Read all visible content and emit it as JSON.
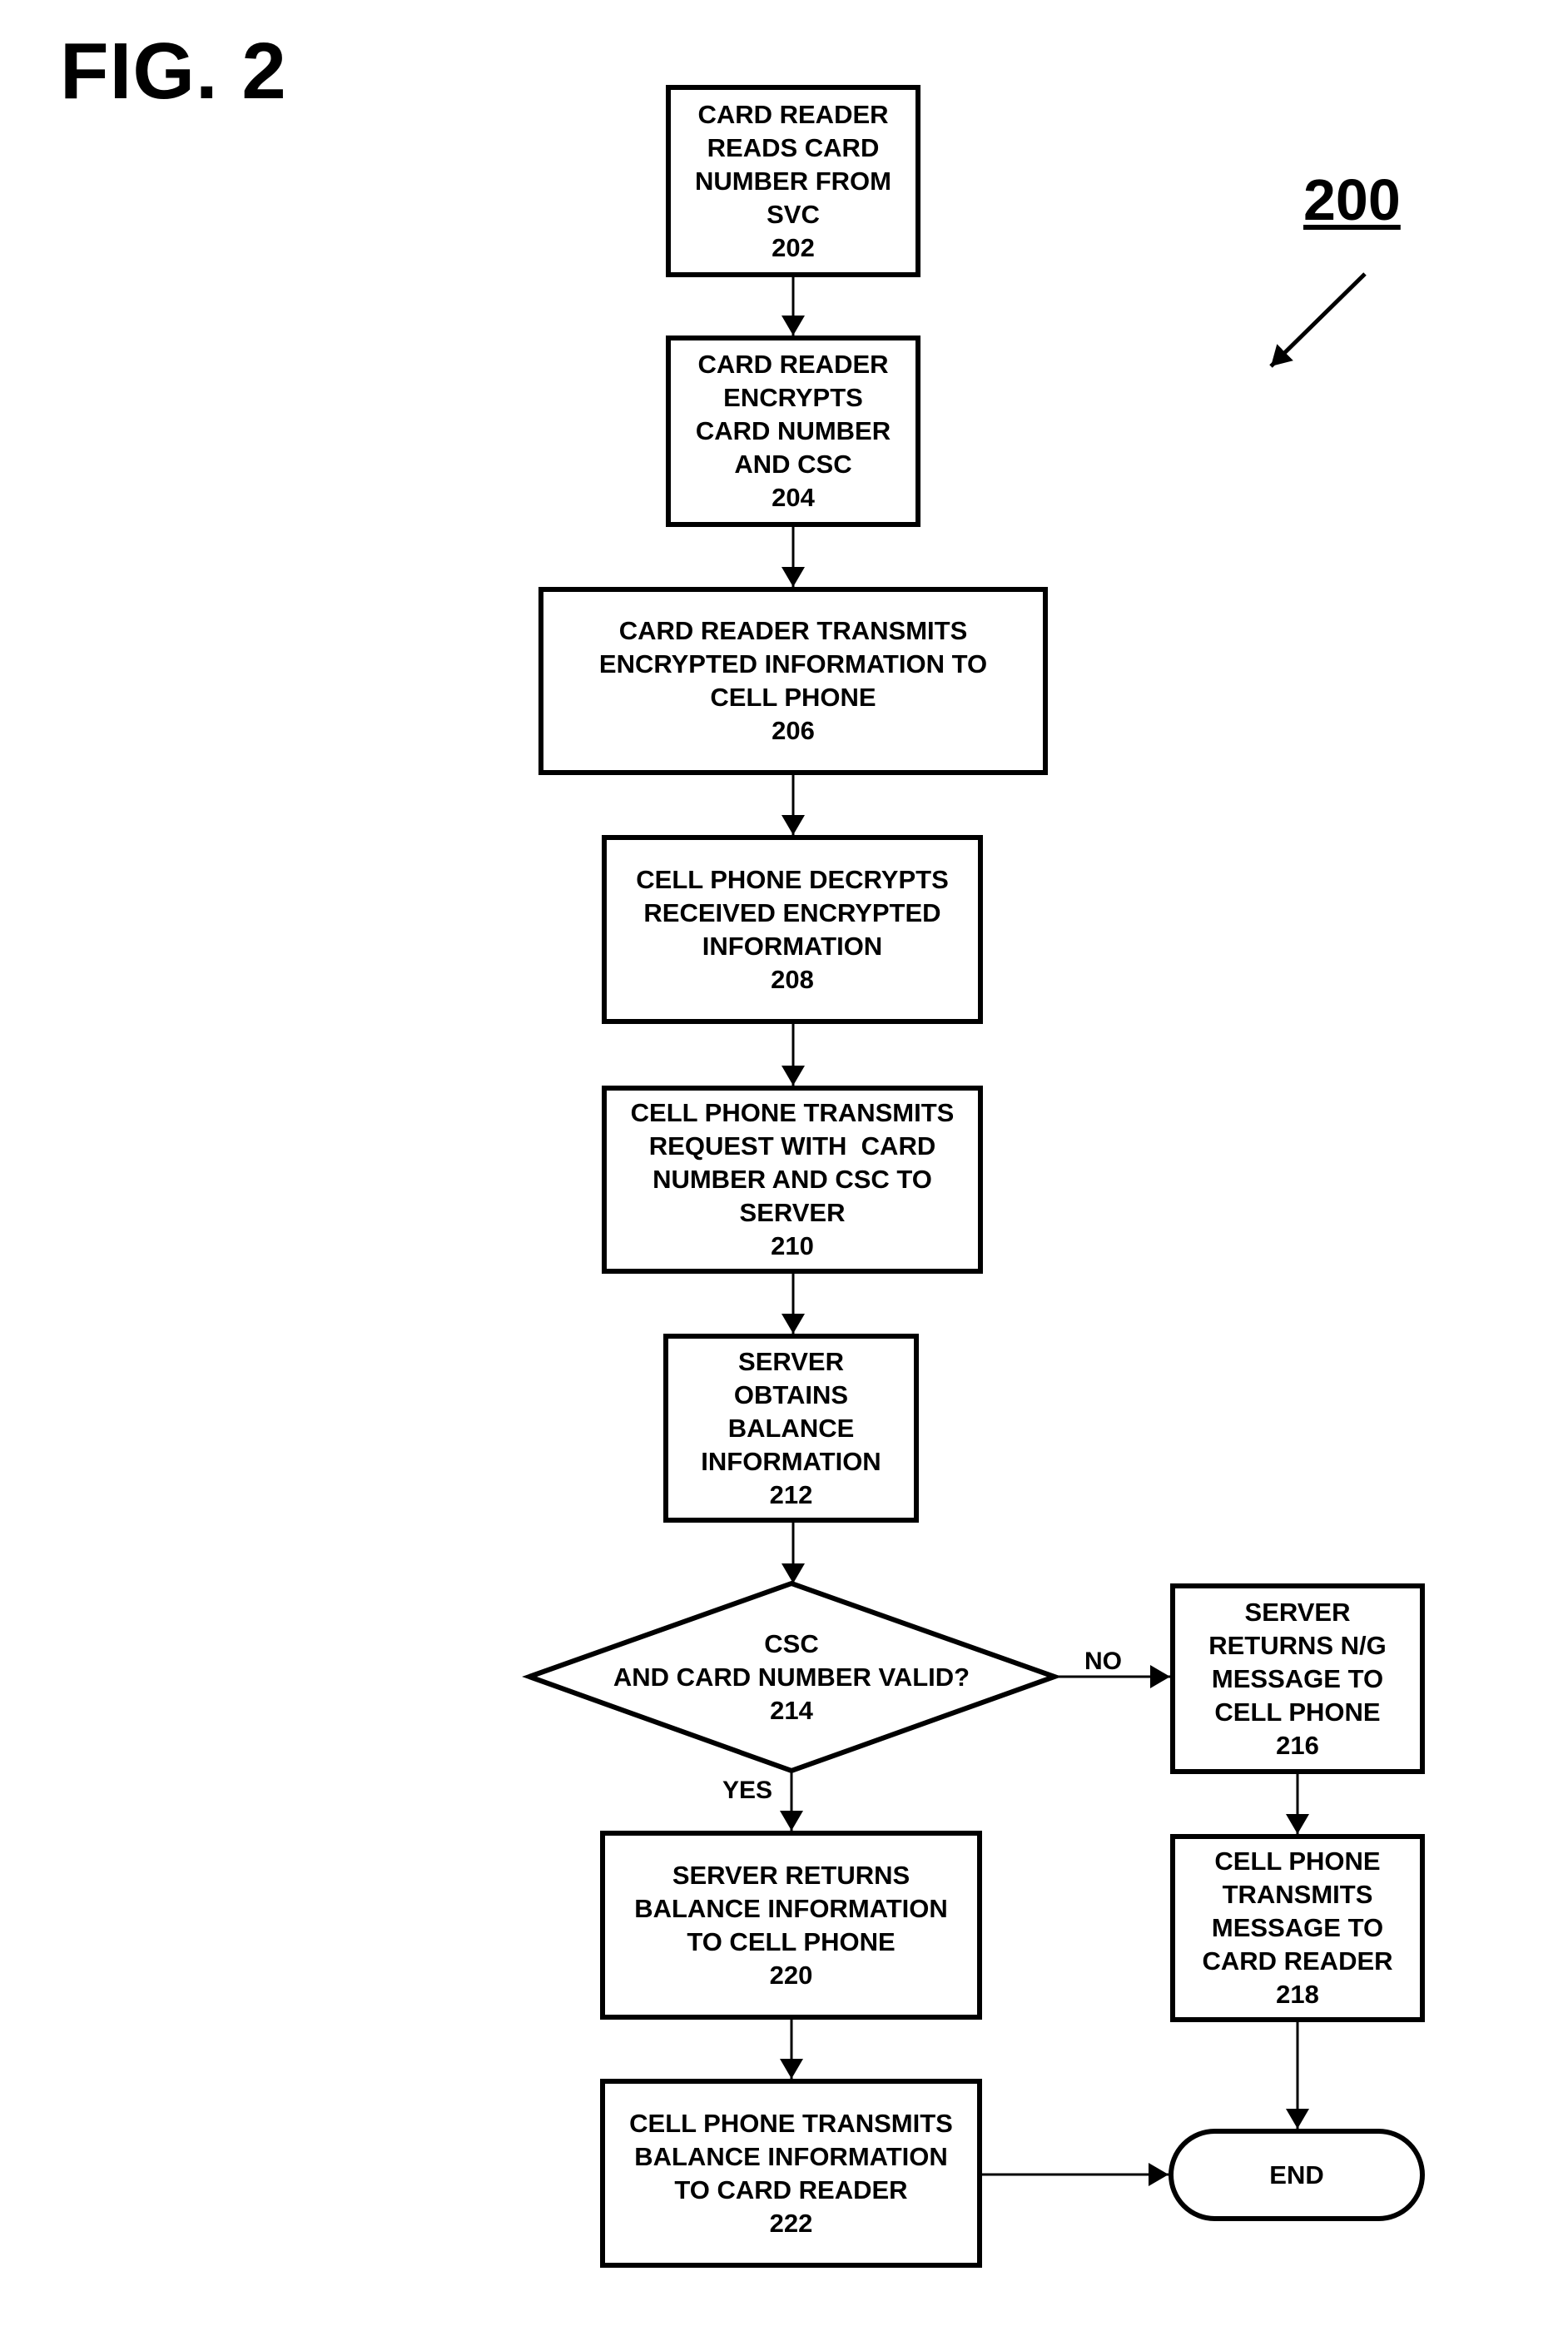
{
  "figure": {
    "title": "FIG. 2",
    "reference_number": "200"
  },
  "nodes": {
    "n202": {
      "lines": [
        "CARD READER",
        "READS CARD",
        "NUMBER FROM",
        "SVC"
      ],
      "id": "202",
      "type": "process"
    },
    "n204": {
      "lines": [
        "CARD READER",
        "ENCRYPTS",
        "CARD NUMBER",
        "AND CSC"
      ],
      "id": "204",
      "type": "process"
    },
    "n206": {
      "lines": [
        "CARD READER TRANSMITS",
        "ENCRYPTED INFORMATION TO",
        "CELL PHONE"
      ],
      "id": "206",
      "type": "process"
    },
    "n208": {
      "lines": [
        "CELL PHONE DECRYPTS",
        "RECEIVED ENCRYPTED",
        "INFORMATION"
      ],
      "id": "208",
      "type": "process"
    },
    "n210": {
      "lines": [
        "CELL PHONE TRANSMITS",
        "REQUEST WITH  CARD",
        "NUMBER AND CSC TO",
        "SERVER"
      ],
      "id": "210",
      "type": "process"
    },
    "n212": {
      "lines": [
        "SERVER",
        "OBTAINS",
        "BALANCE",
        "INFORMATION"
      ],
      "id": "212",
      "type": "process"
    },
    "n214": {
      "lines": [
        "CSC",
        "AND CARD NUMBER VALID?"
      ],
      "id": "214",
      "type": "decision"
    },
    "n216": {
      "lines": [
        "SERVER",
        "RETURNS N/G",
        "MESSAGE TO",
        "CELL PHONE"
      ],
      "id": "216",
      "type": "process"
    },
    "n218": {
      "lines": [
        "CELL PHONE",
        "TRANSMITS",
        "MESSAGE TO",
        "CARD READER"
      ],
      "id": "218",
      "type": "process"
    },
    "n220": {
      "lines": [
        "SERVER RETURNS",
        "BALANCE INFORMATION",
        "TO CELL PHONE"
      ],
      "id": "220",
      "type": "process"
    },
    "n222": {
      "lines": [
        "CELL PHONE TRANSMITS",
        "BALANCE INFORMATION",
        "TO CARD READER"
      ],
      "id": "222",
      "type": "process"
    },
    "end": {
      "lines": [
        "END"
      ],
      "type": "terminal"
    }
  },
  "edges": [
    {
      "from": "202",
      "to": "204"
    },
    {
      "from": "204",
      "to": "206"
    },
    {
      "from": "206",
      "to": "208"
    },
    {
      "from": "208",
      "to": "210"
    },
    {
      "from": "210",
      "to": "212"
    },
    {
      "from": "212",
      "to": "214"
    },
    {
      "from": "214",
      "to": "216",
      "label": "NO"
    },
    {
      "from": "214",
      "to": "220",
      "label": "YES"
    },
    {
      "from": "216",
      "to": "218"
    },
    {
      "from": "218",
      "to": "END"
    },
    {
      "from": "220",
      "to": "222"
    },
    {
      "from": "222",
      "to": "END"
    }
  ],
  "edge_labels": {
    "no": "NO",
    "yes": "YES"
  }
}
